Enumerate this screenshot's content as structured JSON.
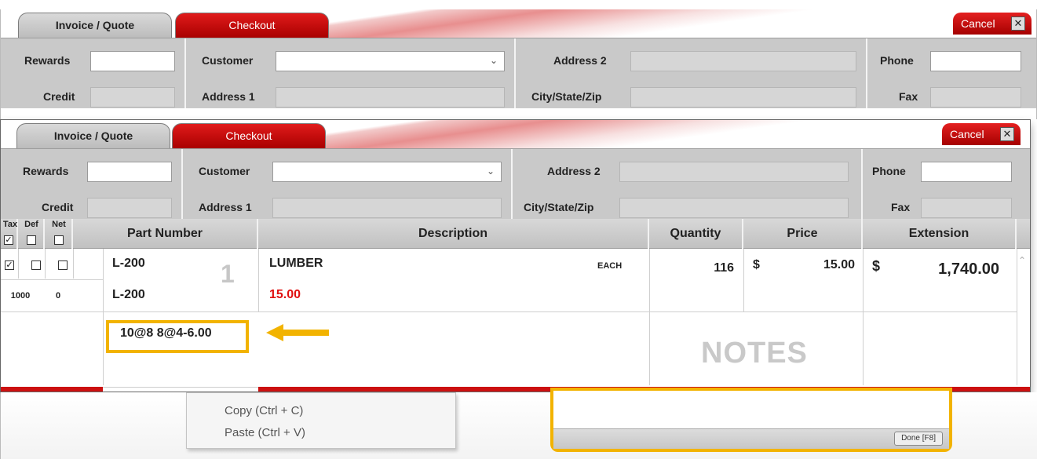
{
  "tabs": {
    "invoice": "Invoice / Quote",
    "checkout": "Checkout"
  },
  "cancel_label": "Cancel",
  "close_glyph": "✕",
  "header": {
    "rewards_label": "Rewards",
    "credit_label": "Credit",
    "customer_label": "Customer",
    "address1_label": "Address 1",
    "address2_label": "Address 2",
    "citystatezip_label": "City/State/Zip",
    "phone_label": "Phone",
    "fax_label": "Fax"
  },
  "grid": {
    "columns": {
      "tax": "Tax",
      "def": "Def",
      "net": "Net",
      "part_number": "Part Number",
      "description": "Description",
      "quantity": "Quantity",
      "price": "Price",
      "extension": "Extension"
    },
    "row": {
      "line_number": "1",
      "part_number": "L-200",
      "part_number_2": "L-200",
      "description": "LUMBER",
      "unit": "EACH",
      "quantity": "116",
      "price_symbol": "$",
      "price": "15.00",
      "extension_symbol": "$",
      "extension": "1,740.00",
      "sub_price": "15.00",
      "sub_value_1": "1000",
      "sub_value_2": "0",
      "pricing_note": "10@8 8@4-6.00",
      "notes_watermark": "NOTES",
      "tax_checked": true,
      "def_checked": false,
      "net_checked": false
    }
  },
  "context_menu": {
    "copy": "Copy (Ctrl + C)",
    "paste": "Paste (Ctrl + V)"
  },
  "notes_panel": {
    "done_label": "Done [F8]"
  },
  "colors": {
    "accent_red": "#cc1010",
    "highlight": "#f2b300",
    "price_red": "#e01010"
  }
}
